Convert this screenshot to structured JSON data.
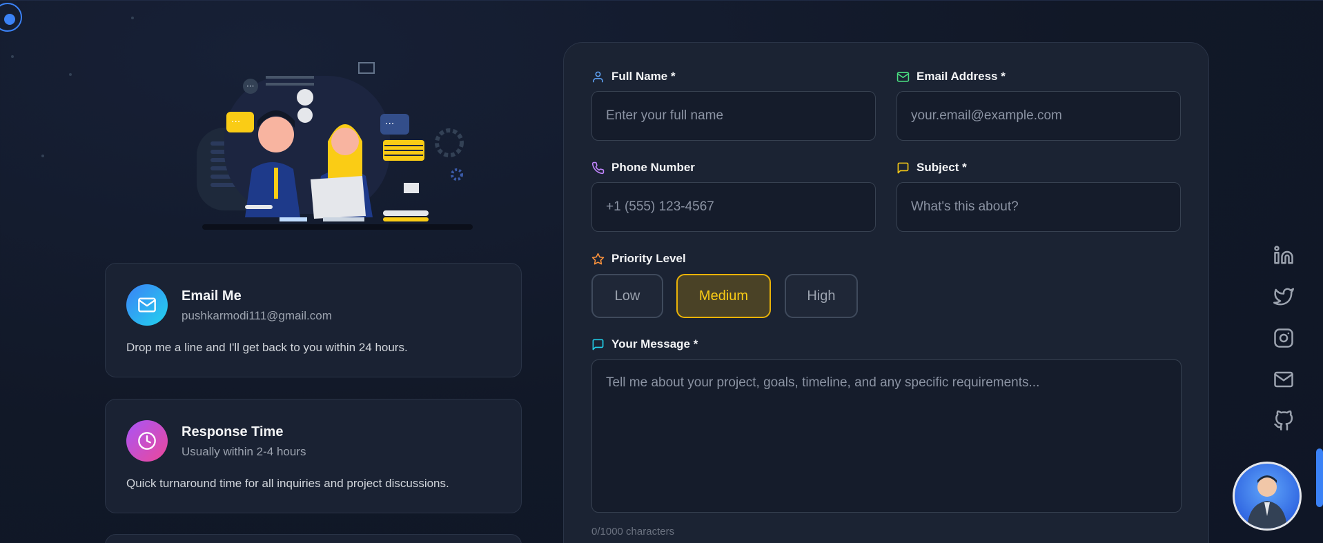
{
  "contact_cards": [
    {
      "title": "Email Me",
      "subtitle": "pushkarmodi111@gmail.com",
      "description": "Drop me a line and I'll get back to you within 24 hours.",
      "icon": "mail-icon",
      "gradient": [
        "#3b82f6",
        "#22d3ee"
      ]
    },
    {
      "title": "Response Time",
      "subtitle": "Usually within 2-4 hours",
      "description": "Quick turnaround time for all inquiries and project discussions.",
      "icon": "clock-icon",
      "gradient": [
        "#a855f7",
        "#ec4899"
      ]
    }
  ],
  "form": {
    "full_name": {
      "label": "Full Name *",
      "placeholder": "Enter your full name",
      "value": "",
      "icon": "user-icon",
      "icon_color": "#60a5fa"
    },
    "email": {
      "label": "Email Address *",
      "placeholder": "your.email@example.com",
      "value": "",
      "icon": "mail-icon",
      "icon_color": "#4ade80"
    },
    "phone": {
      "label": "Phone Number",
      "placeholder": "+1 (555) 123-4567",
      "value": "",
      "icon": "phone-icon",
      "icon_color": "#c084fc"
    },
    "subject": {
      "label": "Subject *",
      "placeholder": "What's this about?",
      "value": "",
      "icon": "message-square-icon",
      "icon_color": "#facc15"
    },
    "priority": {
      "label": "Priority Level",
      "icon": "star-icon",
      "icon_color": "#fb923c",
      "options": [
        "Low",
        "Medium",
        "High"
      ],
      "selected": "Medium"
    },
    "message": {
      "label": "Your Message *",
      "placeholder": "Tell me about your project, goals, timeline, and any specific requirements...",
      "value": "",
      "icon": "message-square-icon",
      "icon_color": "#22d3ee"
    },
    "char_count": "0/1000 characters"
  },
  "social_links": [
    "linkedin-icon",
    "twitter-icon",
    "instagram-icon",
    "mail-icon",
    "github-icon"
  ],
  "colors": {
    "background": "#111827",
    "panel": "#1b2333",
    "accent": "#3b82f6",
    "priority_active": "#eab308"
  }
}
